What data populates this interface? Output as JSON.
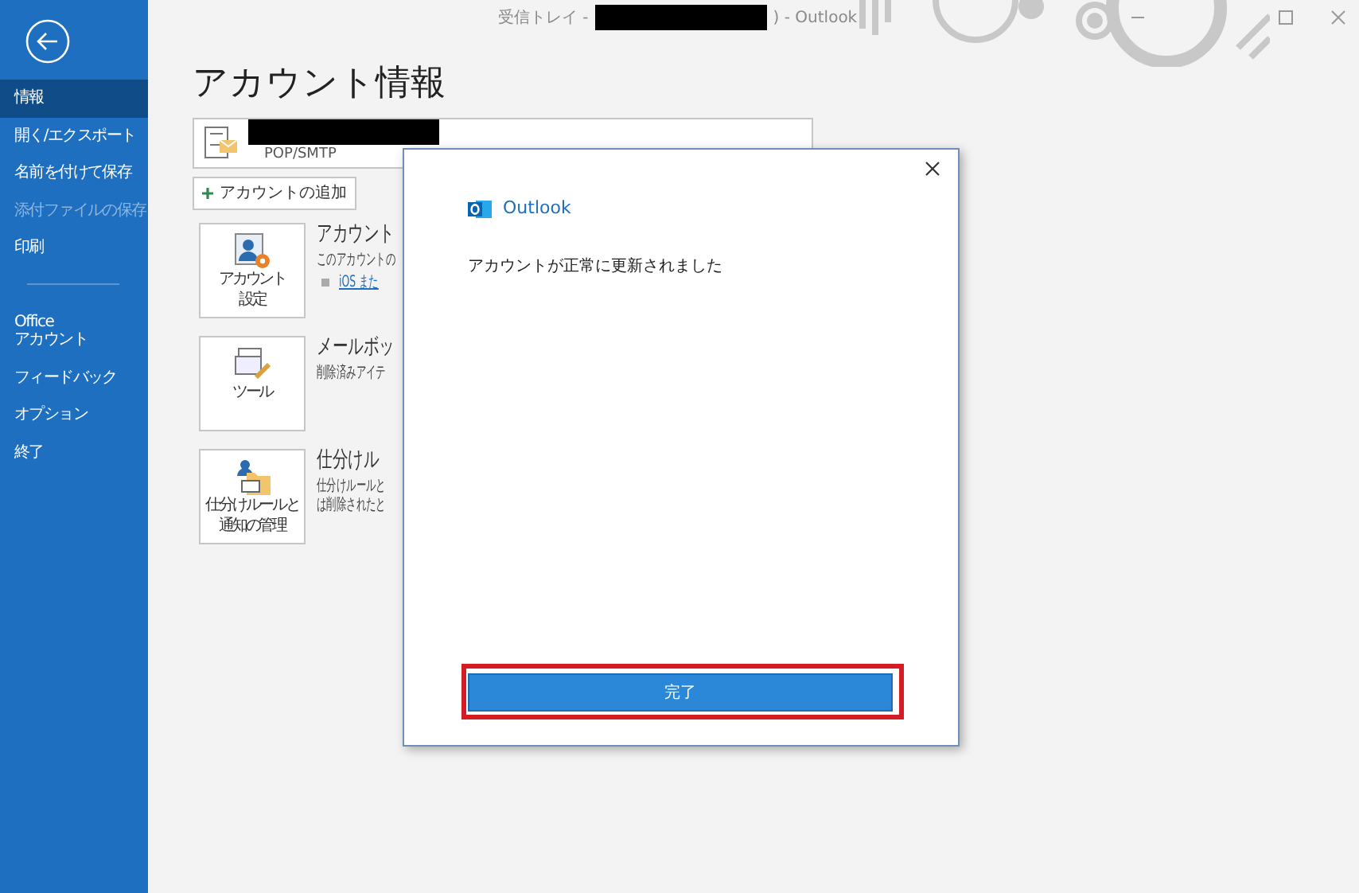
{
  "window": {
    "title_prefix": "受信トレイ -",
    "title_suffix": ")  -  Outlook"
  },
  "sidebar": {
    "items": [
      {
        "kind": "item",
        "label": "情報",
        "selected": true,
        "disabled": false
      },
      {
        "kind": "item",
        "label": "開く/エクスポート",
        "selected": false,
        "disabled": false
      },
      {
        "kind": "item",
        "label": "名前を付けて保存",
        "selected": false,
        "disabled": false
      },
      {
        "kind": "item",
        "label": "添付ファイルの保存",
        "selected": false,
        "disabled": true
      },
      {
        "kind": "item",
        "label": "印刷",
        "selected": false,
        "disabled": false
      },
      {
        "kind": "divider"
      },
      {
        "kind": "item",
        "label": "Office\nアカウント",
        "selected": false,
        "disabled": false
      },
      {
        "kind": "item",
        "label": "フィードバック",
        "selected": false,
        "disabled": false
      },
      {
        "kind": "item",
        "label": "オプション",
        "selected": false,
        "disabled": false
      },
      {
        "kind": "item",
        "label": "終了",
        "selected": false,
        "disabled": false
      }
    ]
  },
  "main": {
    "heading": "アカウント情報",
    "account": {
      "type": "POP/SMTP"
    },
    "add_account": "アカウントの追加",
    "sections": [
      {
        "kind": "settings",
        "tile_label": [
          "アカウント",
          "設定"
        ],
        "title": "アカウント",
        "lines": [
          "このアカウントの"
        ],
        "link": "iOS また"
      },
      {
        "kind": "tools",
        "tile_label": [
          "ツール"
        ],
        "title": "メールボッ",
        "lines": [
          "削除済みアイテ"
        ]
      },
      {
        "kind": "rules",
        "tile_label": [
          "仕分けルールと",
          "通知の管理"
        ],
        "title": "仕分けル",
        "lines": [
          "仕分けルールと",
          "は削除されたと"
        ]
      }
    ]
  },
  "dialog": {
    "app_name": "Outlook",
    "message": "アカウントが正常に更新されました",
    "button": "完了"
  }
}
